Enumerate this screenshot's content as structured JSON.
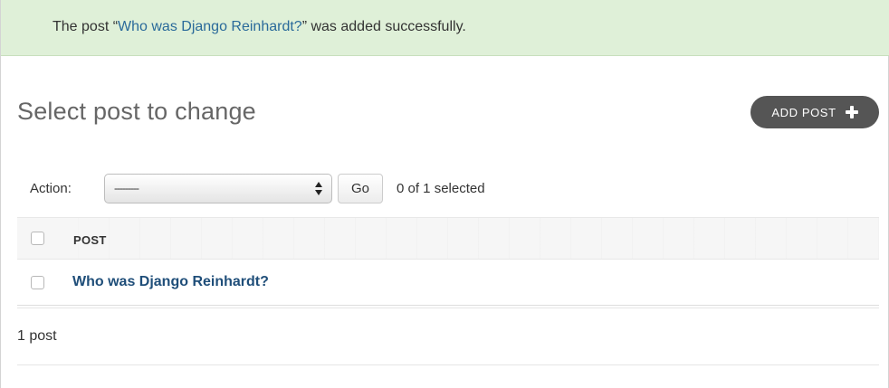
{
  "message": {
    "prefix": "The post “",
    "link_text": "Who was Django Reinhardt?",
    "suffix": "” was added successfully."
  },
  "header": {
    "title": "Select post to change",
    "add_button_label": "ADD POST",
    "add_button_icon": "plus-icon"
  },
  "actions": {
    "label": "Action:",
    "selected_value": "---------",
    "go_label": "Go",
    "counter": "0 of 1 selected"
  },
  "table": {
    "columns": [
      "POST"
    ],
    "rows": [
      {
        "post": "Who was Django Reinhardt?"
      }
    ]
  },
  "paginator": {
    "text": "1 post"
  },
  "colors": {
    "success_background": "#dff0d8",
    "link": "#2a6a9a",
    "row_link": "#1f4e79",
    "button_dark": "#555555"
  }
}
